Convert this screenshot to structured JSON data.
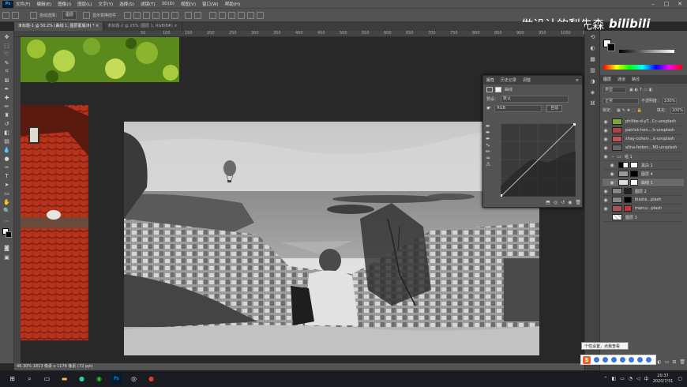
{
  "menu": {
    "app_icon": "Ps",
    "items": [
      "文件(F)",
      "编辑(E)",
      "图像(I)",
      "图层(L)",
      "文字(Y)",
      "选择(S)",
      "滤镜(T)",
      "3D(D)",
      "视图(V)",
      "窗口(W)",
      "帮助(H)"
    ]
  },
  "options": {
    "auto_select": "自动选择：",
    "layer_select": "图层",
    "show_transform": "显示变换控件"
  },
  "tabs": [
    {
      "label": "未标题-1 @ 50.2% (曲线 1, 图层蒙版/8) *"
    },
    {
      "label": "未标题-2 @ 25% (图层 1, RGB/8#)"
    }
  ],
  "ruler_labels": [
    "50",
    "100",
    "150",
    "200",
    "250",
    "300",
    "350",
    "400",
    "450",
    "500",
    "550",
    "600",
    "650",
    "700",
    "750",
    "800",
    "850",
    "900",
    "950",
    "1000",
    "1050",
    "1100"
  ],
  "watermark": {
    "chinese": "做设计的梨先森",
    "brand": "bilibili"
  },
  "status": "46.30%    1813 像素 x 1176 像素 (72 ppi)",
  "properties": {
    "tabs": [
      "属性",
      "历史记录",
      "调整"
    ],
    "title": "曲线",
    "preset_label": "预设：",
    "preset_value": "默认",
    "channel_value": "RGB",
    "auto_button": "自动"
  },
  "right_panel": {
    "tabs": [
      "图层",
      "通道",
      "路径"
    ],
    "kind_filter": "类型",
    "blend_mode": "正常",
    "opacity_label": "不透明度：",
    "opacity_value": "100%",
    "lock_label": "锁定：",
    "fill_label": "填充：",
    "fill_value": "100%"
  },
  "layers": [
    {
      "name": "phil​ibe-d-yT...Cc-unsplash"
    },
    {
      "name": "patrick-hen...-k-unsplash"
    },
    {
      "name": "shay-cohen-...k-unsplash"
    },
    {
      "name": "alina-fedorc...N0-unsplash"
    },
    {
      "name": "组 1"
    },
    {
      "name": "黑白 1"
    },
    {
      "name": "图层 4"
    },
    {
      "name": "曲线 1"
    },
    {
      "name": "图层 2"
    },
    {
      "name": "blasta...plash"
    },
    {
      "name": "marcu...plash"
    },
    {
      "name": "图层 3"
    }
  ],
  "tooltip": "个性设置，点我查看",
  "clock": {
    "time": "20:37",
    "date": "2020/7/31"
  },
  "colors": {
    "accent": "#31a8ff",
    "panel": "#535353",
    "canvas_bg": "#282828"
  }
}
